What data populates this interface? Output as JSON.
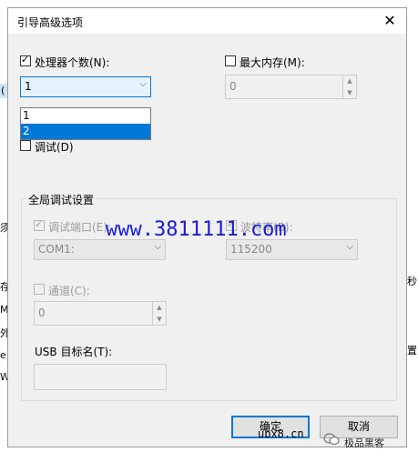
{
  "dialog": {
    "title": "引导高级选项",
    "close_icon": "close-icon"
  },
  "processor": {
    "checkbox_label": "处理器个数(N):",
    "checked": true,
    "selected": "1",
    "options": [
      "1",
      "2"
    ],
    "highlighted_option": "2"
  },
  "max_memory": {
    "checkbox_label": "最大内存(M):",
    "checked": false,
    "value": "0"
  },
  "pci_lock": {
    "checkbox_label": "调试(D)",
    "checked": false
  },
  "global_debug": {
    "group_title": "全局调试设置",
    "debug_port_label": "调试端口(E):",
    "debug_port_checked": true,
    "debug_port_value": "COM1:",
    "baud_rate_label": "波特率(B):",
    "baud_rate_checked": true,
    "baud_rate_value": "115200",
    "channel_label": "通道(C):",
    "channel_checked": false,
    "channel_value": "0",
    "usb_target_label": "USB 目标名(T):",
    "usb_target_value": ""
  },
  "buttons": {
    "ok": "确定",
    "cancel": "取消"
  },
  "background_fragments": {
    "f1": "(",
    "f2": "须",
    "f3": "存",
    "f4": "M",
    "f5": "外",
    "f6": "e",
    "f7": "W",
    "f8": "秒",
    "f9": "置"
  },
  "watermarks": {
    "main": "www.3811111.com",
    "site": "ubx8.cn",
    "account": "极品黑客"
  },
  "colors": {
    "accent": "#0078d7",
    "watermark": "#1a1ad6"
  }
}
